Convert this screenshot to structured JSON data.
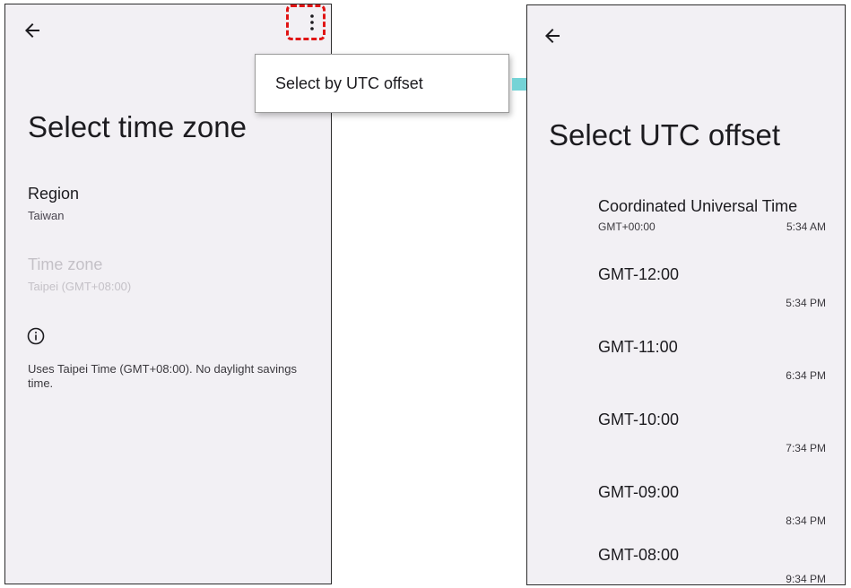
{
  "left_screen": {
    "title": "Select time zone",
    "region": {
      "label": "Region",
      "value": "Taiwan"
    },
    "time_zone": {
      "label": "Time zone",
      "value": "Taipei (GMT+08:00)"
    },
    "info_text": "Uses Taipei Time (GMT+08:00). No daylight savings time."
  },
  "overflow_menu": {
    "items": [
      "Select by UTC offset"
    ]
  },
  "right_screen": {
    "title": "Select UTC offset",
    "offsets": [
      {
        "name": "Coordinated Universal Time",
        "offset": "GMT+00:00",
        "time": "5:34 AM"
      },
      {
        "name": "GMT-12:00",
        "offset": "",
        "time": "5:34 PM"
      },
      {
        "name": "GMT-11:00",
        "offset": "",
        "time": "6:34 PM"
      },
      {
        "name": "GMT-10:00",
        "offset": "",
        "time": "7:34 PM"
      },
      {
        "name": "GMT-09:00",
        "offset": "",
        "time": "8:34 PM"
      },
      {
        "name": "GMT-08:00",
        "offset": "",
        "time": "9:34 PM"
      }
    ]
  },
  "colors": {
    "screen_bg": "#f2f0f4",
    "highlight": "#e01414",
    "arrow": "#74d3d6",
    "disabled_text": "#c4c1c7"
  },
  "icons": [
    "back-arrow-icon",
    "more-vert-icon",
    "info-icon",
    "right-arrow-icon"
  ]
}
